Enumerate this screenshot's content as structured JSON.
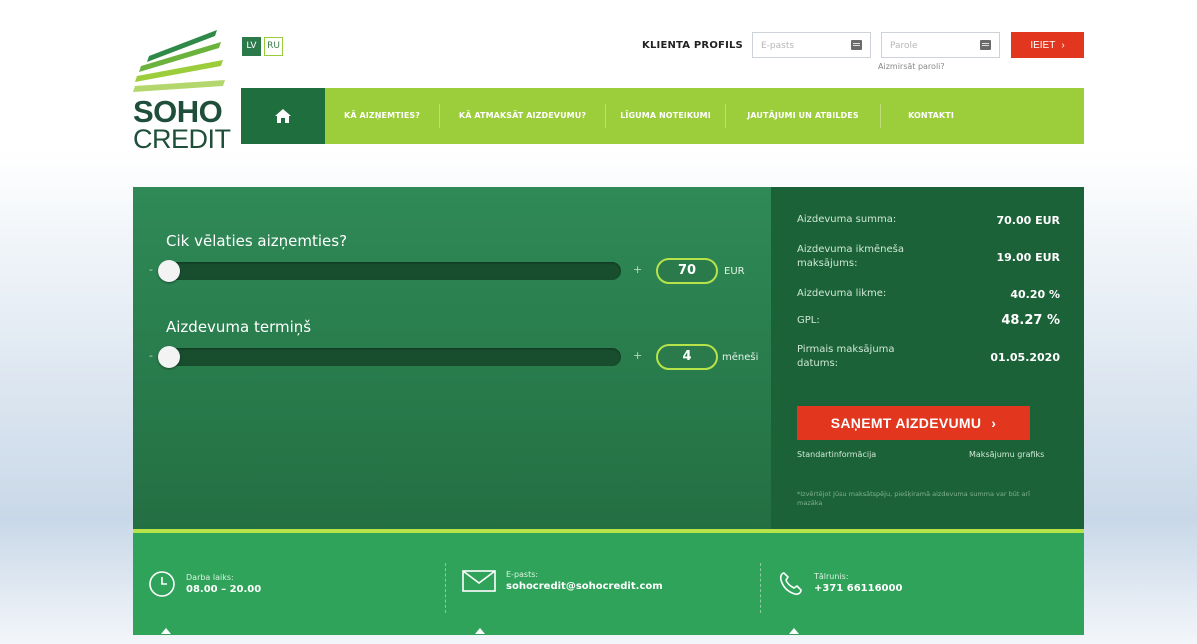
{
  "brand": {
    "name_line1": "SOHO",
    "name_line2": "CREDIT"
  },
  "languages": [
    {
      "code": "LV",
      "active": true
    },
    {
      "code": "RU",
      "active": false
    }
  ],
  "header": {
    "profile_label": "KLIENTA PROFILS",
    "email_placeholder": "E-pasts",
    "password_placeholder": "Parole",
    "forgot_password": "Aizmirsāt paroli?",
    "login_button": "IEIET"
  },
  "nav": {
    "home_icon": "home-icon",
    "items": [
      "KĀ AIZŅEMTIES?",
      "KĀ ATMAKSĀT AIZDEVUMU?",
      "LĪGUMA NOTEIKUMI",
      "JAUTĀJUMI UN ATBILDES",
      "KONTAKTI"
    ]
  },
  "calculator": {
    "amount": {
      "title": "Cik vēlaties aizņemties?",
      "value": "70",
      "unit": "EUR",
      "minus": "-",
      "plus": "+",
      "level": 0
    },
    "term": {
      "title": "Aizdevuma termiņš",
      "value": "4",
      "unit": "mēneši",
      "minus": "-",
      "plus": "+",
      "level": 0
    }
  },
  "summary": {
    "rows": [
      {
        "label": "Aizdevuma summa:",
        "value": "70.00 EUR"
      },
      {
        "label": "Aizdevuma ikmēneša maksājums:",
        "value": "19.00 EUR"
      },
      {
        "label": "Aizdevuma likme:",
        "value": "40.20 %"
      },
      {
        "label": "GPL:",
        "value": "48.27 %"
      },
      {
        "label": "Pirmais maksājuma datums:",
        "value": "01.05.2020"
      }
    ],
    "cta": "SAŅEMT AIZDEVUMU",
    "link_standard": "Standartinformācija",
    "link_schedule": "Maksājumu grafiks",
    "disclaimer": "*Izvērtējot Jūsu maksātspēju, piešķiramā aizdevuma summa var būt arī mazāka"
  },
  "footer": {
    "hours": {
      "label": "Darba laiks:",
      "value": "08.00 – 20.00"
    },
    "email": {
      "label": "E-pasts:",
      "value": "sohocredit@sohocredit.com"
    },
    "phone": {
      "label": "Tālrunis:",
      "value": "+371 66116000"
    }
  },
  "colors": {
    "accent_red": "#e2361e",
    "nav_green": "#9ccd3a",
    "dark_green": "#1c6238",
    "footer_green": "#2fa35a"
  }
}
